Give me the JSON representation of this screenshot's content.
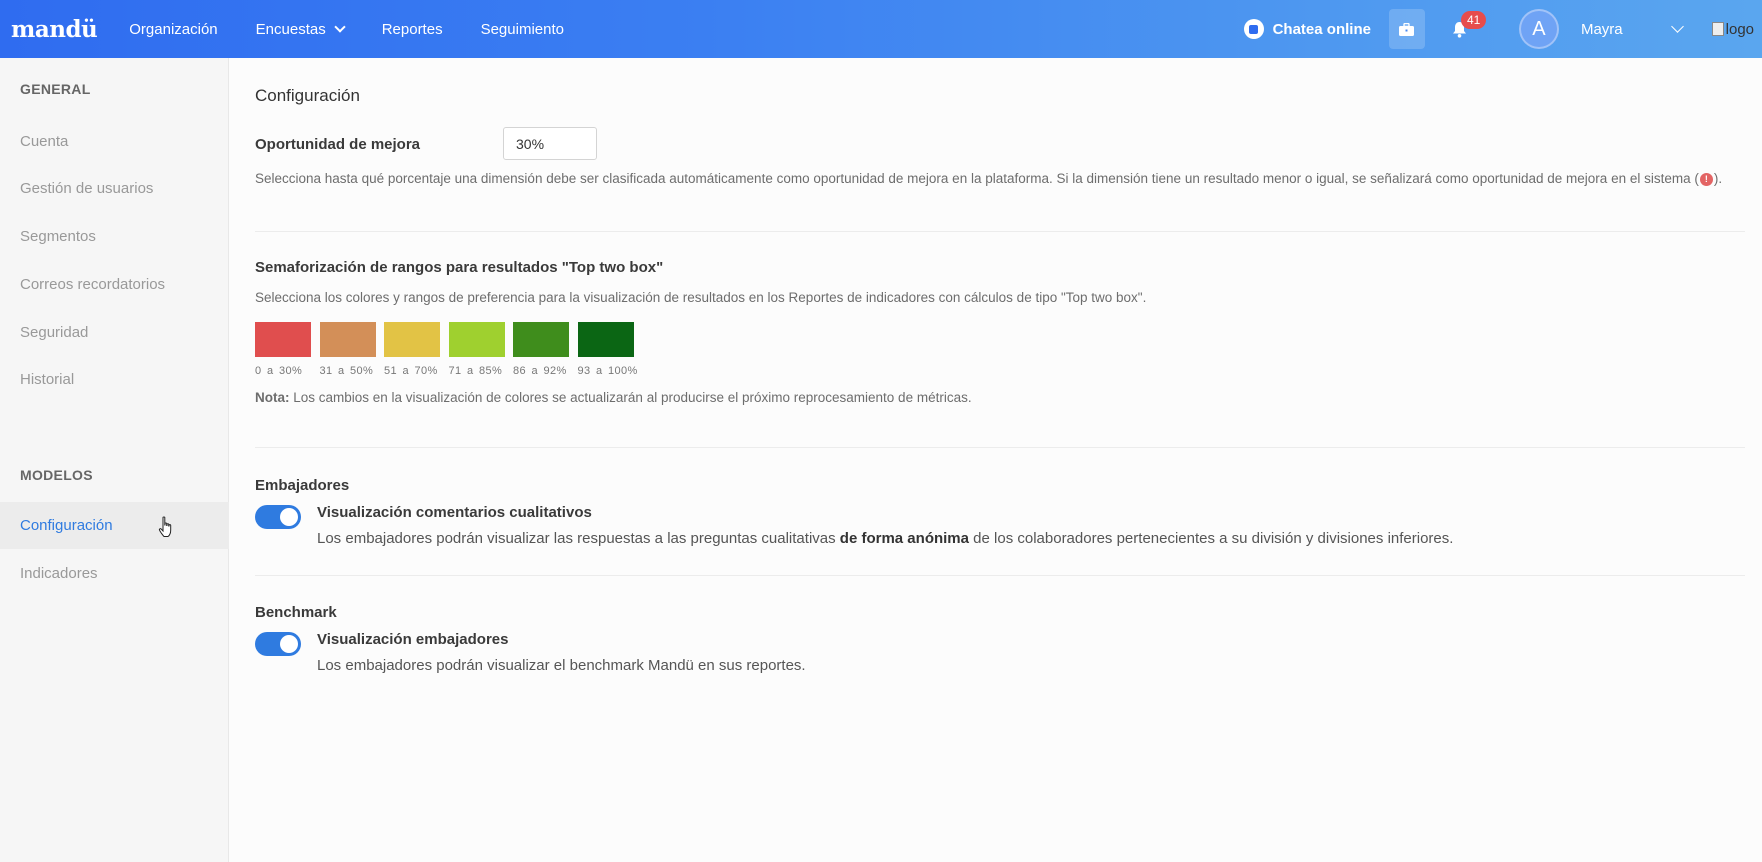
{
  "header": {
    "logo": "mandü",
    "nav": [
      "Organización",
      "Encuestas",
      "Reportes",
      "Seguimiento"
    ],
    "chat_label": "Chatea online",
    "notifications_count": "41",
    "avatar_initial": "A",
    "username": "Mayra",
    "logo_alt": "logo"
  },
  "sidebar": {
    "general_heading": "GENERAL",
    "general_items": [
      "Cuenta",
      "Gestión de usuarios",
      "Segmentos",
      "Correos recordatorios",
      "Seguridad",
      "Historial"
    ],
    "models_heading": "MODELOS",
    "models_items": [
      "Configuración",
      "Indicadores"
    ]
  },
  "main": {
    "title": "Configuración",
    "improvement": {
      "label": "Oportunidad de mejora",
      "value": "30%",
      "description_before": "Selecciona hasta qué porcentaje una dimensión debe ser clasificada automáticamente como oportunidad de mejora en la plataforma. Si la dimensión tiene un resultado menor o igual, se señalizará como oportunidad de mejora en el sistema (",
      "description_after": ")."
    },
    "top_two_box": {
      "label": "Semaforización de rangos para resultados \"Top two box\"",
      "description": "Selecciona los colores y rangos de preferencia para la visualización de resultados en los Reportes de indicadores con cálculos de tipo \"Top two box\".",
      "ranges": [
        {
          "label": "0 a 30%",
          "color": "#e04e4e"
        },
        {
          "label": "31 a 50%",
          "color": "#d38f58"
        },
        {
          "label": "51 a 70%",
          "color": "#e2c345"
        },
        {
          "label": "71 a 85%",
          "color": "#9fd02f"
        },
        {
          "label": "86 a 92%",
          "color": "#3f8d1c"
        },
        {
          "label": "93 a 100%",
          "color": "#0b6614"
        }
      ],
      "note_bold": "Nota:",
      "note_text": " Los cambios en la visualización de colores se actualizarán al producirse el próximo reprocesamiento de métricas."
    },
    "ambassadors": {
      "label": "Embajadores",
      "toggle_title": "Visualización comentarios cualitativos",
      "desc_before": "Los embajadores podrán visualizar las respuestas a las preguntas cualitativas ",
      "desc_bold": "de forma anónima",
      "desc_after": " de los colaboradores pertenecientes a su división y divisiones inferiores."
    },
    "benchmark": {
      "label": "Benchmark",
      "toggle_title": "Visualización embajadores",
      "description": "Los embajadores podrán visualizar el benchmark Mandü en sus reportes."
    }
  }
}
